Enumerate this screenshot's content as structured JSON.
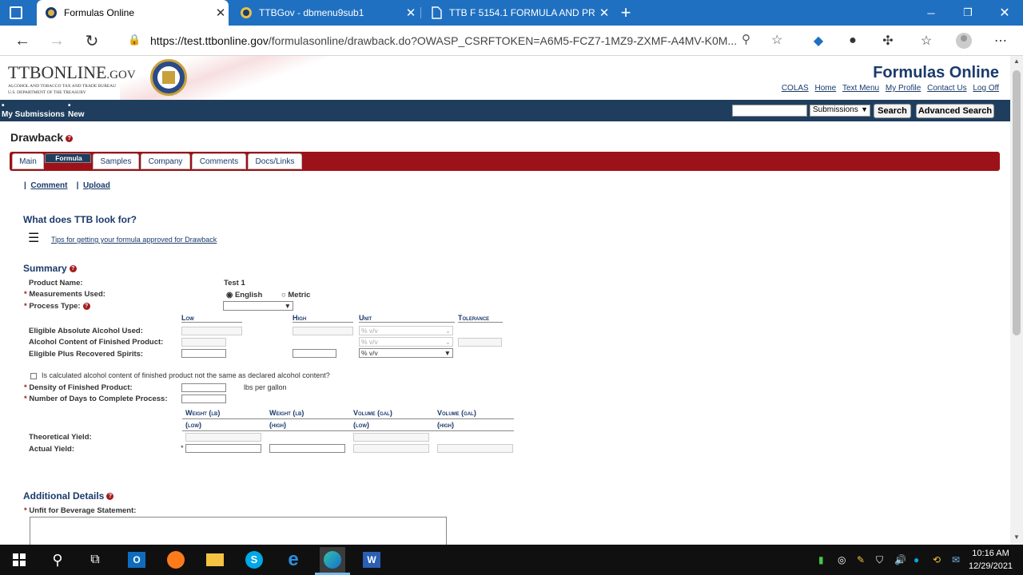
{
  "browser": {
    "tabs": [
      {
        "title": "Formulas Online",
        "active": true
      },
      {
        "title": "TTBGov - dbmenu9sub1",
        "active": false
      },
      {
        "title": "TTB F 5154.1 FORMULA AND PR",
        "active": false
      }
    ],
    "url_host": "https://test.ttbonline.gov",
    "url_path": "/formulasonline/drawback.do?OWASP_CSRFTOKEN=A6M5-FCZ7-1MZ9-ZXMF-A4MV-K0M..."
  },
  "header": {
    "logo_main": "TTBONLINE",
    "logo_gov": ".GOV",
    "logo_sub1": "ALCOHOL AND TOBACCO TAX AND TRADE BUREAU",
    "logo_sub2": "U.S. DEPARTMENT OF THE TREASURY",
    "app_name": "Formulas Online",
    "links": [
      "COLAS",
      "Home",
      "Text Menu",
      "My Profile",
      "Contact Us",
      "Log Off"
    ]
  },
  "navbar": {
    "my_submissions": "My Submissions",
    "new": "New",
    "search_select": "Submissions",
    "search_button": "Search",
    "advanced_search_button": "Advanced Search"
  },
  "page": {
    "title": "Drawback",
    "tabs": [
      "Main",
      "Formula",
      "Samples",
      "Company",
      "Comments",
      "Docs/Links"
    ],
    "selected_tab": "Formula",
    "sublinks": [
      "Comment",
      "Upload"
    ],
    "ttb_heading": "What does TTB look for?",
    "tips_link": "Tips for getting your formula approved for Drawback",
    "summary_heading": "Summary",
    "product_name_label": "Product Name:",
    "product_name_value": "Test 1",
    "measurements_label": "Measurements Used:",
    "measurements_english": "English",
    "measurements_metric": "Metric",
    "measurements_selected": "English",
    "process_type_label": "Process Type:",
    "col_low": "Low",
    "col_high": "High",
    "col_unit": "Unit",
    "col_tolerance": "Tolerance",
    "eligible_abs_label": "Eligible Absolute Alcohol Used:",
    "alcohol_content_label": "Alcohol Content of Finished Product:",
    "eligible_plus_label": "Eligible Plus Recovered Spirits:",
    "unit_value": "% v/v",
    "calc_checkbox_label": "Is calculated alcohol content of finished product not the same as declared alcohol content?",
    "density_label": "Density of Finished Product:",
    "density_unit": "lbs per gallon",
    "days_label": "Number of Days to Complete Process:",
    "yield_cols": [
      {
        "line1": "Weight (lb)",
        "line2": "(low)"
      },
      {
        "line1": "Weight (lb)",
        "line2": "(high)"
      },
      {
        "line1": "Volume (gal)",
        "line2": "(low)"
      },
      {
        "line1": "Volume (gal)",
        "line2": "(high)"
      }
    ],
    "theoretical_yield_label": "Theoretical Yield:",
    "actual_yield_label": "Actual Yield:",
    "additional_heading": "Additional Details",
    "unfit_label": "Unfit for Beverage Statement:"
  },
  "taskbar": {
    "time": "10:16 AM",
    "date": "12/29/2021"
  }
}
